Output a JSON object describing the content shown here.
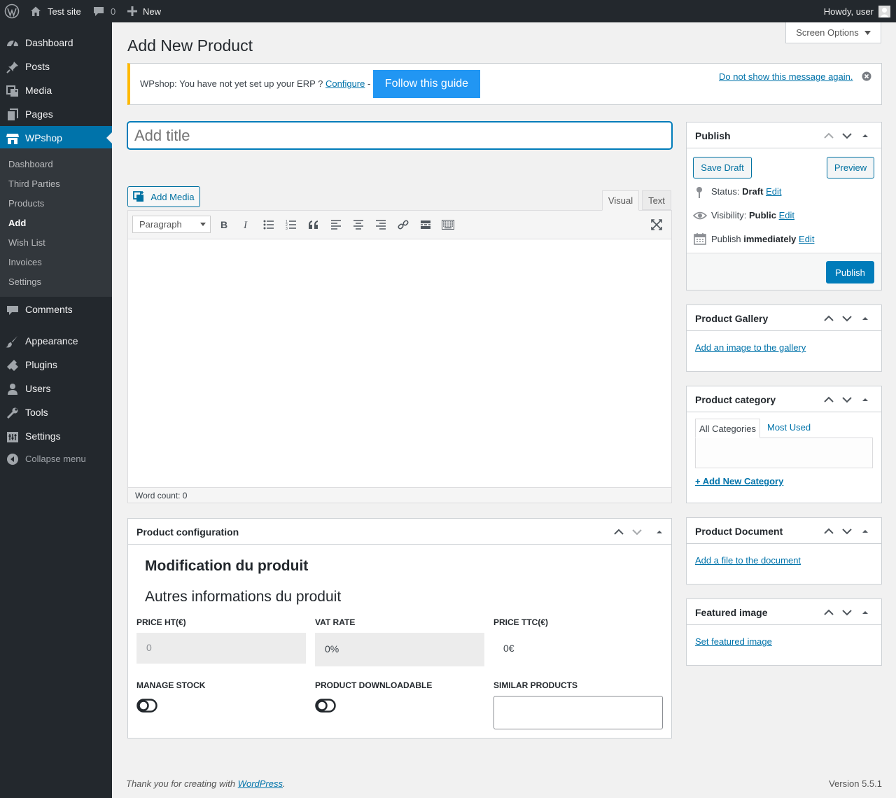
{
  "adminbar": {
    "site_name": "Test site",
    "comments_count": "0",
    "new_label": "New",
    "howdy": "Howdy, user"
  },
  "menu": {
    "items": [
      {
        "label": "Dashboard",
        "icon": "dashboard-icon"
      },
      {
        "label": "Posts",
        "icon": "pin-icon"
      },
      {
        "label": "Media",
        "icon": "media-icon"
      },
      {
        "label": "Pages",
        "icon": "pages-icon"
      },
      {
        "label": "WPshop",
        "icon": "store-icon"
      }
    ],
    "submenu": [
      "Dashboard",
      "Third Parties",
      "Products",
      "Add",
      "Wish List",
      "Invoices",
      "Settings"
    ],
    "lower_items": [
      {
        "label": "Comments",
        "icon": "comments-icon"
      },
      {
        "label": "Appearance",
        "icon": "appearance-icon"
      },
      {
        "label": "Plugins",
        "icon": "plugins-icon"
      },
      {
        "label": "Users",
        "icon": "users-icon"
      },
      {
        "label": "Tools",
        "icon": "tools-icon"
      },
      {
        "label": "Settings",
        "icon": "settings-icon"
      }
    ],
    "collapse": "Collapse menu"
  },
  "screen_options": "Screen Options",
  "page_title": "Add New Product",
  "notice": {
    "text": "WPshop: You have not yet set up your ERP ?",
    "configure_link": "Configure",
    "separator": "-",
    "guide_button": "Follow this guide",
    "dismiss_link": "Do not show this message again."
  },
  "title_input": {
    "placeholder": "Add title",
    "value": ""
  },
  "editor": {
    "add_media": "Add Media",
    "tab_visual": "Visual",
    "tab_text": "Text",
    "format_select": "Paragraph",
    "word_count": "Word count: 0"
  },
  "product_config": {
    "title": "Product configuration",
    "heading": "Modification du produit",
    "subheading": "Autres informations du produit",
    "price_ht_label": "PRICE HT(€)",
    "price_ht_placeholder": "0",
    "vat_label": "VAT RATE",
    "vat_value": "0%",
    "price_ttc_label": "PRICE TTC(€)",
    "price_ttc_value": "0€",
    "manage_stock_label": "MANAGE STOCK",
    "downloadable_label": "PRODUCT DOWNLOADABLE",
    "similar_label": "SIMILAR PRODUCTS"
  },
  "publish": {
    "title": "Publish",
    "save_draft": "Save Draft",
    "preview": "Preview",
    "status_label": "Status:",
    "status_value": "Draft",
    "visibility_label": "Visibility:",
    "visibility_value": "Public",
    "schedule_label": "Publish",
    "schedule_value": "immediately",
    "edit": "Edit",
    "publish_button": "Publish"
  },
  "gallery": {
    "title": "Product Gallery",
    "link": "Add an image to the gallery"
  },
  "category": {
    "title": "Product category",
    "tab_all": "All Categories",
    "tab_used": "Most Used",
    "add_link": "+ Add New Category"
  },
  "document": {
    "title": "Product Document",
    "link": "Add a file to the document"
  },
  "featured": {
    "title": "Featured image",
    "link": "Set featured image"
  },
  "footer": {
    "thanks_prefix": "Thank you for creating with",
    "wp_link": "WordPress",
    "thanks_suffix": ".",
    "version": "Version 5.5.1"
  },
  "colors": {
    "accent": "#0073aa",
    "menu_bg": "#23282d",
    "notice_warning": "#ffb900",
    "guide_button": "#2196f3"
  }
}
